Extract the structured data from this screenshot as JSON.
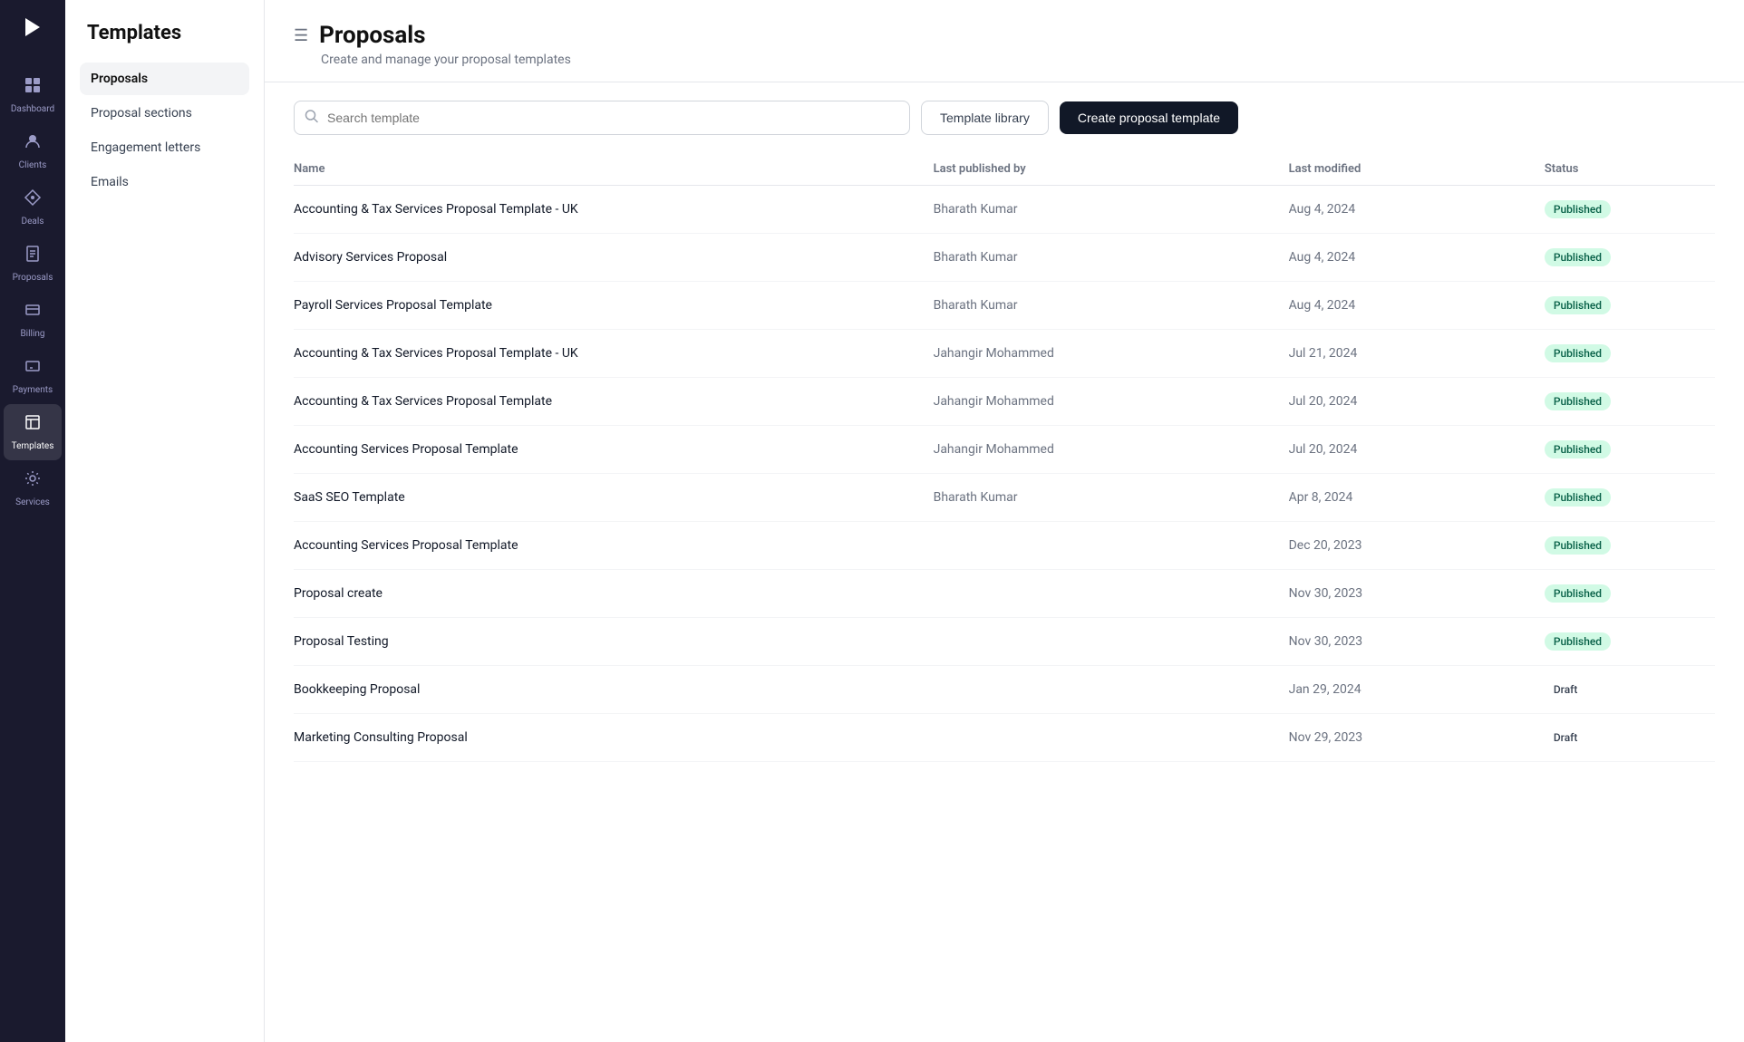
{
  "app": {
    "logo": "▶",
    "title": "Templates",
    "subtitle": "Create and manage your proposal templates"
  },
  "icon_nav": {
    "items": [
      {
        "id": "dashboard",
        "label": "Dashboard",
        "icon": "⊞",
        "active": false
      },
      {
        "id": "clients",
        "label": "Clients",
        "icon": "👤",
        "active": false
      },
      {
        "id": "deals",
        "label": "Deals",
        "icon": "🤝",
        "active": false
      },
      {
        "id": "proposals",
        "label": "Proposals",
        "icon": "📄",
        "active": false
      },
      {
        "id": "billing",
        "label": "Billing",
        "icon": "🧾",
        "active": false
      },
      {
        "id": "payments",
        "label": "Payments",
        "icon": "💳",
        "active": false
      },
      {
        "id": "templates",
        "label": "Templates",
        "icon": "⊟",
        "active": true
      },
      {
        "id": "services",
        "label": "Services",
        "icon": "🔧",
        "active": false
      }
    ]
  },
  "sidebar": {
    "title": "Templates",
    "items": [
      {
        "id": "proposals",
        "label": "Proposals",
        "active": true
      },
      {
        "id": "proposal-sections",
        "label": "Proposal sections",
        "active": false
      },
      {
        "id": "engagement-letters",
        "label": "Engagement letters",
        "active": false
      },
      {
        "id": "emails",
        "label": "Emails",
        "active": false
      }
    ]
  },
  "page": {
    "title": "Proposals",
    "subtitle": "Create and manage your proposal templates"
  },
  "toolbar": {
    "search_placeholder": "Search template",
    "template_library_label": "Template library",
    "create_button_label": "Create proposal template"
  },
  "table": {
    "columns": [
      {
        "id": "name",
        "label": "Name"
      },
      {
        "id": "publisher",
        "label": "Last published by"
      },
      {
        "id": "modified",
        "label": "Last modified"
      },
      {
        "id": "status",
        "label": "Status"
      }
    ],
    "rows": [
      {
        "name": "Accounting & Tax Services Proposal Template - UK",
        "publisher": "Bharath Kumar",
        "modified": "Aug 4, 2024",
        "status": "Published"
      },
      {
        "name": "Advisory Services Proposal",
        "publisher": "Bharath Kumar",
        "modified": "Aug 4, 2024",
        "status": "Published"
      },
      {
        "name": "Payroll Services Proposal Template",
        "publisher": "Bharath Kumar",
        "modified": "Aug 4, 2024",
        "status": "Published"
      },
      {
        "name": "Accounting & Tax Services Proposal Template - UK",
        "publisher": "Jahangir Mohammed",
        "modified": "Jul 21, 2024",
        "status": "Published"
      },
      {
        "name": "Accounting & Tax Services Proposal Template",
        "publisher": "Jahangir Mohammed",
        "modified": "Jul 20, 2024",
        "status": "Published"
      },
      {
        "name": "Accounting Services Proposal Template",
        "publisher": "Jahangir Mohammed",
        "modified": "Jul 20, 2024",
        "status": "Published"
      },
      {
        "name": "SaaS SEO Template",
        "publisher": "Bharath Kumar",
        "modified": "Apr 8, 2024",
        "status": "Published"
      },
      {
        "name": "Accounting Services Proposal Template",
        "publisher": "",
        "modified": "Dec 20, 2023",
        "status": "Published"
      },
      {
        "name": "Proposal create",
        "publisher": "",
        "modified": "Nov 30, 2023",
        "status": "Published"
      },
      {
        "name": "Proposal Testing",
        "publisher": "",
        "modified": "Nov 30, 2023",
        "status": "Published"
      },
      {
        "name": "Bookkeeping Proposal",
        "publisher": "",
        "modified": "Jan 29, 2024",
        "status": "Draft"
      },
      {
        "name": "Marketing Consulting Proposal",
        "publisher": "",
        "modified": "Nov 29, 2023",
        "status": "Draft"
      }
    ]
  }
}
